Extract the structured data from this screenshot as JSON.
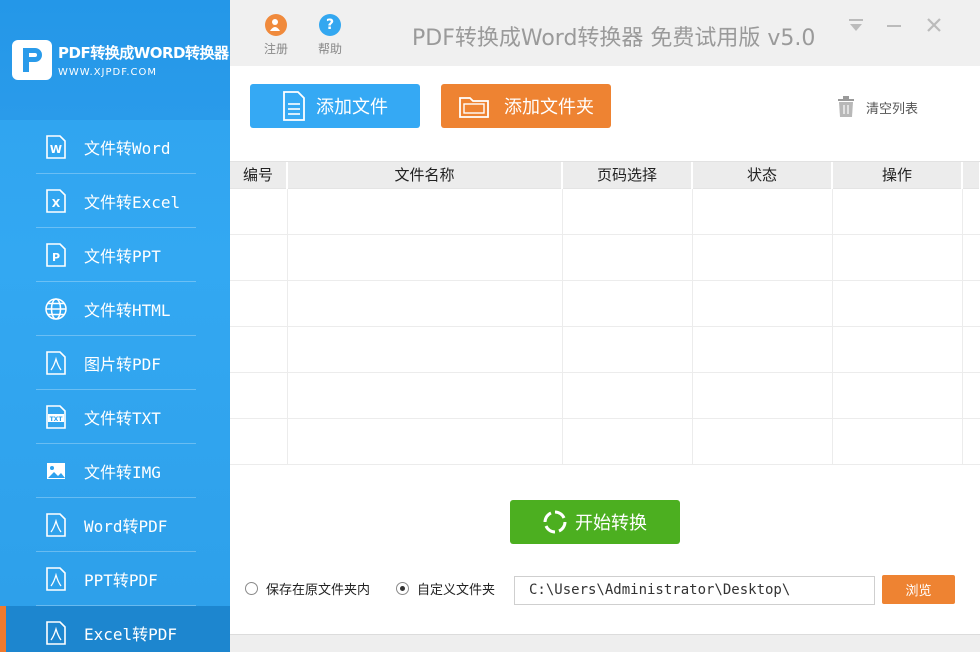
{
  "logo": {
    "title": "PDF转换成WORD转换器",
    "subtitle": "WWW.XJPDF.COM"
  },
  "sidebar": {
    "items": [
      {
        "label": "文件转Word",
        "icon": "word-icon"
      },
      {
        "label": "文件转Excel",
        "icon": "excel-icon"
      },
      {
        "label": "文件转PPT",
        "icon": "ppt-icon"
      },
      {
        "label": "文件转HTML",
        "icon": "globe-icon"
      },
      {
        "label": "图片转PDF",
        "icon": "pdf-icon"
      },
      {
        "label": "文件转TXT",
        "icon": "txt-icon"
      },
      {
        "label": "文件转IMG",
        "icon": "image-icon"
      },
      {
        "label": "Word转PDF",
        "icon": "pdf-icon"
      },
      {
        "label": "PPT转PDF",
        "icon": "pdf-icon"
      },
      {
        "label": "Excel转PDF",
        "icon": "pdf-icon"
      }
    ],
    "active_index": 9
  },
  "titlebar": {
    "register_label": "注册",
    "help_label": "帮助",
    "title": "PDF转换成Word转换器 免费试用版 v5.0",
    "register_color": "#f08a3c",
    "help_color": "#33a7f0"
  },
  "toolbar": {
    "add_file_label": "添加文件",
    "add_folder_label": "添加文件夹",
    "clear_list_label": "清空列表"
  },
  "table": {
    "headers": [
      "编号",
      "文件名称",
      "页码选择",
      "状态",
      "操作"
    ],
    "rows": []
  },
  "actions": {
    "start_label": "开始转换",
    "save_original_label": "保存在原文件夹内",
    "custom_folder_label": "自定义文件夹",
    "selected_option": "custom",
    "path_value": "C:\\Users\\Administrator\\Desktop\\",
    "browse_label": "浏览"
  },
  "colors": {
    "accent_blue": "#35a9f4",
    "accent_orange": "#ee8332",
    "start_green": "#4caf20"
  }
}
